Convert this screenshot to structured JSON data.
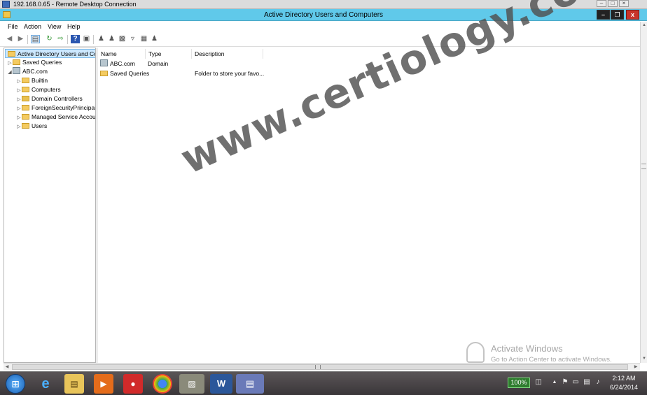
{
  "rdp": {
    "title": "192.168.0.65 - Remote Desktop Connection",
    "controls": [
      "–",
      "□",
      "×"
    ]
  },
  "window": {
    "title": "Active Directory Users and Computers",
    "minimize": "–",
    "restore": "❐",
    "close": "x"
  },
  "menu": [
    "File",
    "Action",
    "View",
    "Help"
  ],
  "toolbar": {
    "icons": [
      "back-icon",
      "forward-icon",
      "show-console-tree-icon",
      "refresh-icon",
      "export-list-icon",
      "help-icon",
      "properties-icon",
      "add-user-icon",
      "add-group-icon",
      "add-ou-icon",
      "filter-icon",
      "find-icon",
      "add-to-group-icon"
    ]
  },
  "tree": {
    "root": "Active Directory Users and Com",
    "items": [
      {
        "label": "Saved Queries",
        "level": 1
      },
      {
        "label": "ABC.com",
        "level": 1
      },
      {
        "label": "Builtin",
        "level": 2
      },
      {
        "label": "Computers",
        "level": 2
      },
      {
        "label": "Domain Controllers",
        "level": 2
      },
      {
        "label": "ForeignSecurityPrincipals",
        "level": 2
      },
      {
        "label": "Managed Service Accoun",
        "level": 2
      },
      {
        "label": "Users",
        "level": 2
      }
    ]
  },
  "list": {
    "columns": [
      "Name",
      "Type",
      "Description"
    ],
    "rows": [
      {
        "name": "ABC.com",
        "type": "Domain",
        "description": ""
      },
      {
        "name": "Saved Queries",
        "type": "",
        "description": "Folder to store your favo..."
      }
    ]
  },
  "watermark": {
    "site": "www.certiology.com",
    "activate_title": "Activate Windows",
    "activate_sub": "Go to Action Center to activate Windows."
  },
  "taskbar": {
    "apps": [
      "start-button",
      "internet-explorer-icon",
      "file-explorer-icon",
      "media-player-icon",
      "security-app-icon",
      "chrome-icon",
      "photos-icon",
      "word-icon",
      "remote-desktop-icon"
    ],
    "battery": "100%",
    "time": "2:12 AM",
    "date": "6/24/2014"
  },
  "colors": {
    "app_titlebar": "#60c9ea",
    "selection": "#cce8ff",
    "folder": "#f4cb61"
  }
}
